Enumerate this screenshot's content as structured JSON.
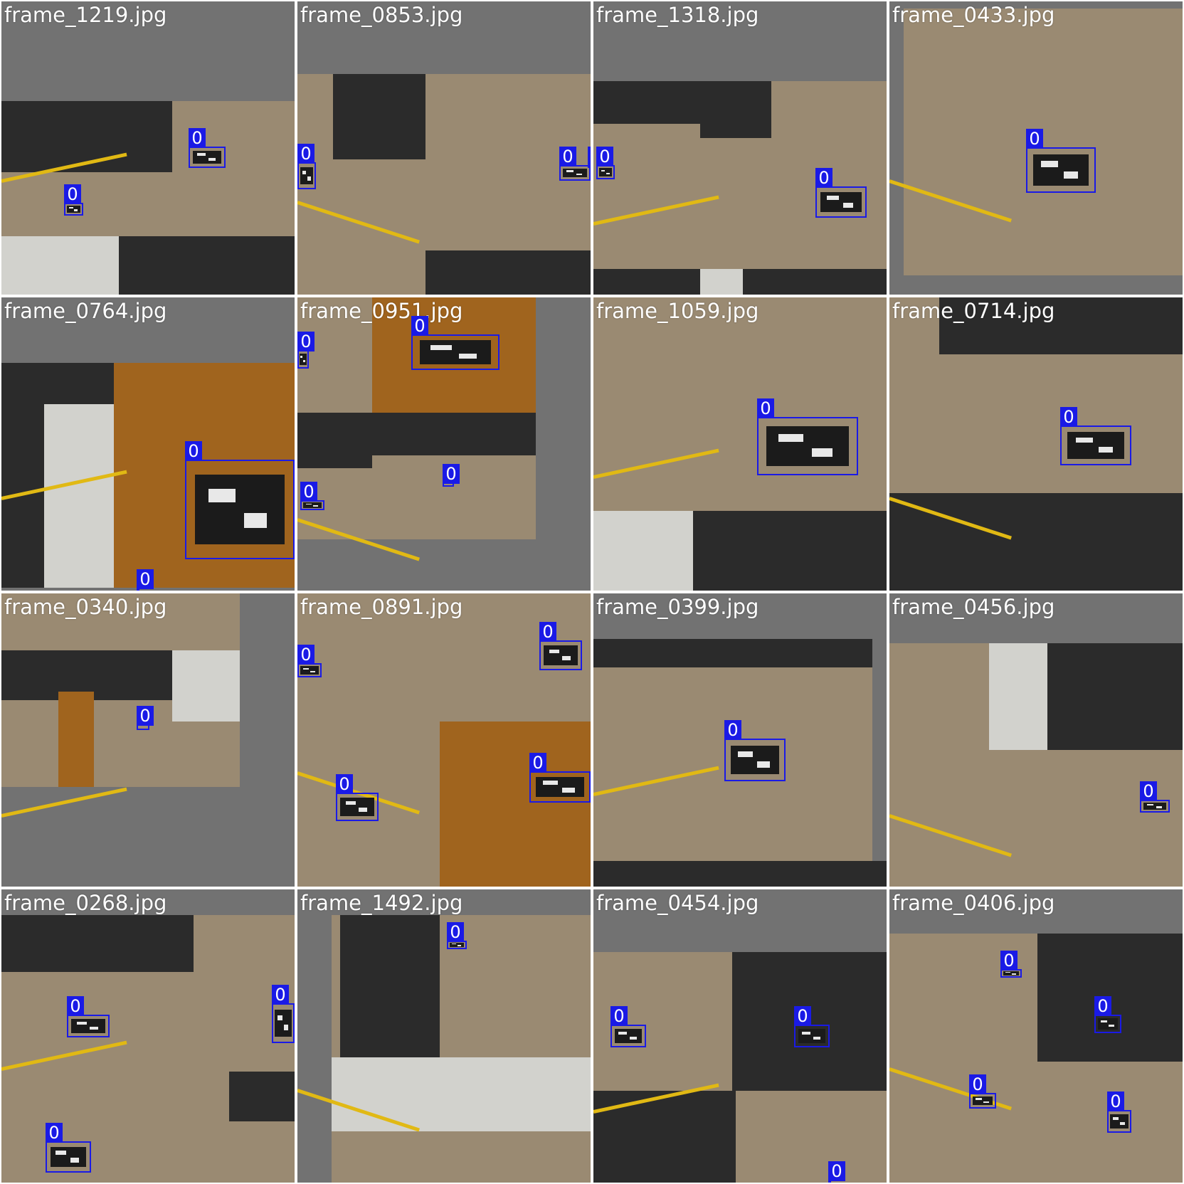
{
  "grid": {
    "tiles": [
      {
        "name": "frame_1219.jpg",
        "detections": [
          {
            "label": "0"
          },
          {
            "label": "0"
          }
        ]
      },
      {
        "name": "frame_0853.jpg",
        "detections": [
          {
            "label": "0"
          },
          {
            "label": "0"
          },
          {
            "label": "0"
          }
        ]
      },
      {
        "name": "frame_1318.jpg",
        "detections": [
          {
            "label": "0"
          },
          {
            "label": "0"
          }
        ]
      },
      {
        "name": "frame_0433.jpg",
        "detections": [
          {
            "label": "0"
          }
        ]
      },
      {
        "name": "frame_0764.jpg",
        "detections": [
          {
            "label": "0"
          },
          {
            "label": "0"
          }
        ]
      },
      {
        "name": "frame_0951.jpg",
        "detections": [
          {
            "label": "0"
          },
          {
            "label": "0"
          },
          {
            "label": "0"
          },
          {
            "label": "0"
          }
        ]
      },
      {
        "name": "frame_1059.jpg",
        "detections": [
          {
            "label": "0"
          }
        ]
      },
      {
        "name": "frame_0714.jpg",
        "detections": [
          {
            "label": "0"
          }
        ]
      },
      {
        "name": "frame_0340.jpg",
        "detections": [
          {
            "label": "0"
          }
        ]
      },
      {
        "name": "frame_0891.jpg",
        "detections": [
          {
            "label": "0"
          },
          {
            "label": "0"
          },
          {
            "label": "0"
          },
          {
            "label": "0"
          }
        ]
      },
      {
        "name": "frame_0399.jpg",
        "detections": [
          {
            "label": "0"
          }
        ]
      },
      {
        "name": "frame_0456.jpg",
        "detections": [
          {
            "label": "0"
          }
        ]
      },
      {
        "name": "frame_0268.jpg",
        "detections": [
          {
            "label": "0"
          },
          {
            "label": "0"
          },
          {
            "label": "0"
          }
        ]
      },
      {
        "name": "frame_1492.jpg",
        "detections": [
          {
            "label": "0"
          }
        ]
      },
      {
        "name": "frame_0454.jpg",
        "detections": [
          {
            "label": "0"
          },
          {
            "label": "0"
          },
          {
            "label": "0"
          }
        ]
      },
      {
        "name": "frame_0406.jpg",
        "detections": [
          {
            "label": "0"
          },
          {
            "label": "0"
          },
          {
            "label": "0"
          },
          {
            "label": "0"
          }
        ]
      }
    ]
  },
  "colors": {
    "box": "#1a1ae6",
    "label_text": "#ffffff",
    "padding_gray": "#727272",
    "floor": "#9a8a72",
    "wood": "#a0641e",
    "cabinet": "#2b2b2b",
    "wall": "#d2d2cd",
    "tape": "#e1b914"
  }
}
